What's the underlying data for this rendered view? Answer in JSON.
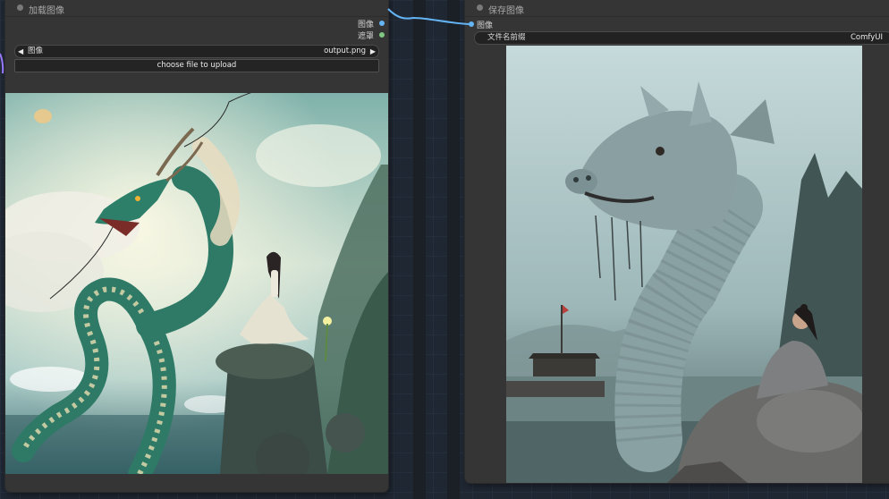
{
  "load_node": {
    "title": "加载图像",
    "outputs": {
      "image": "图像",
      "mask": "遮罩"
    },
    "image_widget": {
      "label": "图像",
      "value": "output.png",
      "left_arrow": "◀",
      "right_arrow": "▶"
    },
    "upload_button": "choose file to upload",
    "preview_alt": "dragon-and-woman-image"
  },
  "save_node": {
    "title": "保存图像",
    "inputs": {
      "image": "图像"
    },
    "prefix_widget": {
      "label": "文件名前缀",
      "value": "ComfyUI"
    },
    "preview_alt": "sea-serpent-and-woman-image"
  },
  "colors": {
    "canvas": "#1f2733",
    "node_body": "#353535",
    "image_port": "#64b5f6",
    "mask_port": "#81c784",
    "wire": "#64b5f6"
  }
}
